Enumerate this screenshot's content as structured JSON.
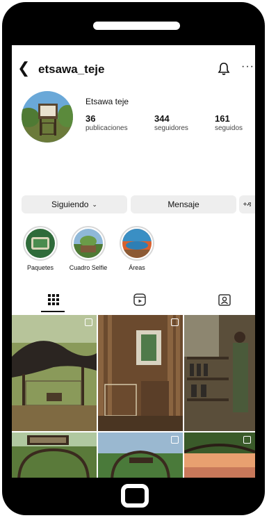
{
  "header": {
    "back_icon": "chevron-left-icon",
    "username": "etsawa_teje",
    "bell_icon": "bell-icon",
    "more_icon": "more-horizontal-icon",
    "more_glyph": "···"
  },
  "profile": {
    "display_name": "Etsawa teje",
    "stats": [
      {
        "value": "36",
        "label": "publicaciones"
      },
      {
        "value": "344",
        "label": "seguidores"
      },
      {
        "value": "161",
        "label": "seguidos"
      }
    ]
  },
  "actions": {
    "following_label": "Siguiendo",
    "following_chevron": "⌄",
    "message_label": "Mensaje",
    "add_person_icon": "add-person-icon",
    "add_person_glyph": "+ዳ"
  },
  "highlights": [
    {
      "label": "Paquetes"
    },
    {
      "label": "Cuadro Selfie"
    },
    {
      "label": "Áreas"
    }
  ],
  "tabs": [
    {
      "icon": "grid-icon",
      "active": true
    },
    {
      "icon": "reels-icon",
      "active": false
    },
    {
      "icon": "tagged-icon",
      "active": false
    }
  ],
  "colors": {
    "button_bg": "#eeeeee",
    "frame": "#000000"
  }
}
